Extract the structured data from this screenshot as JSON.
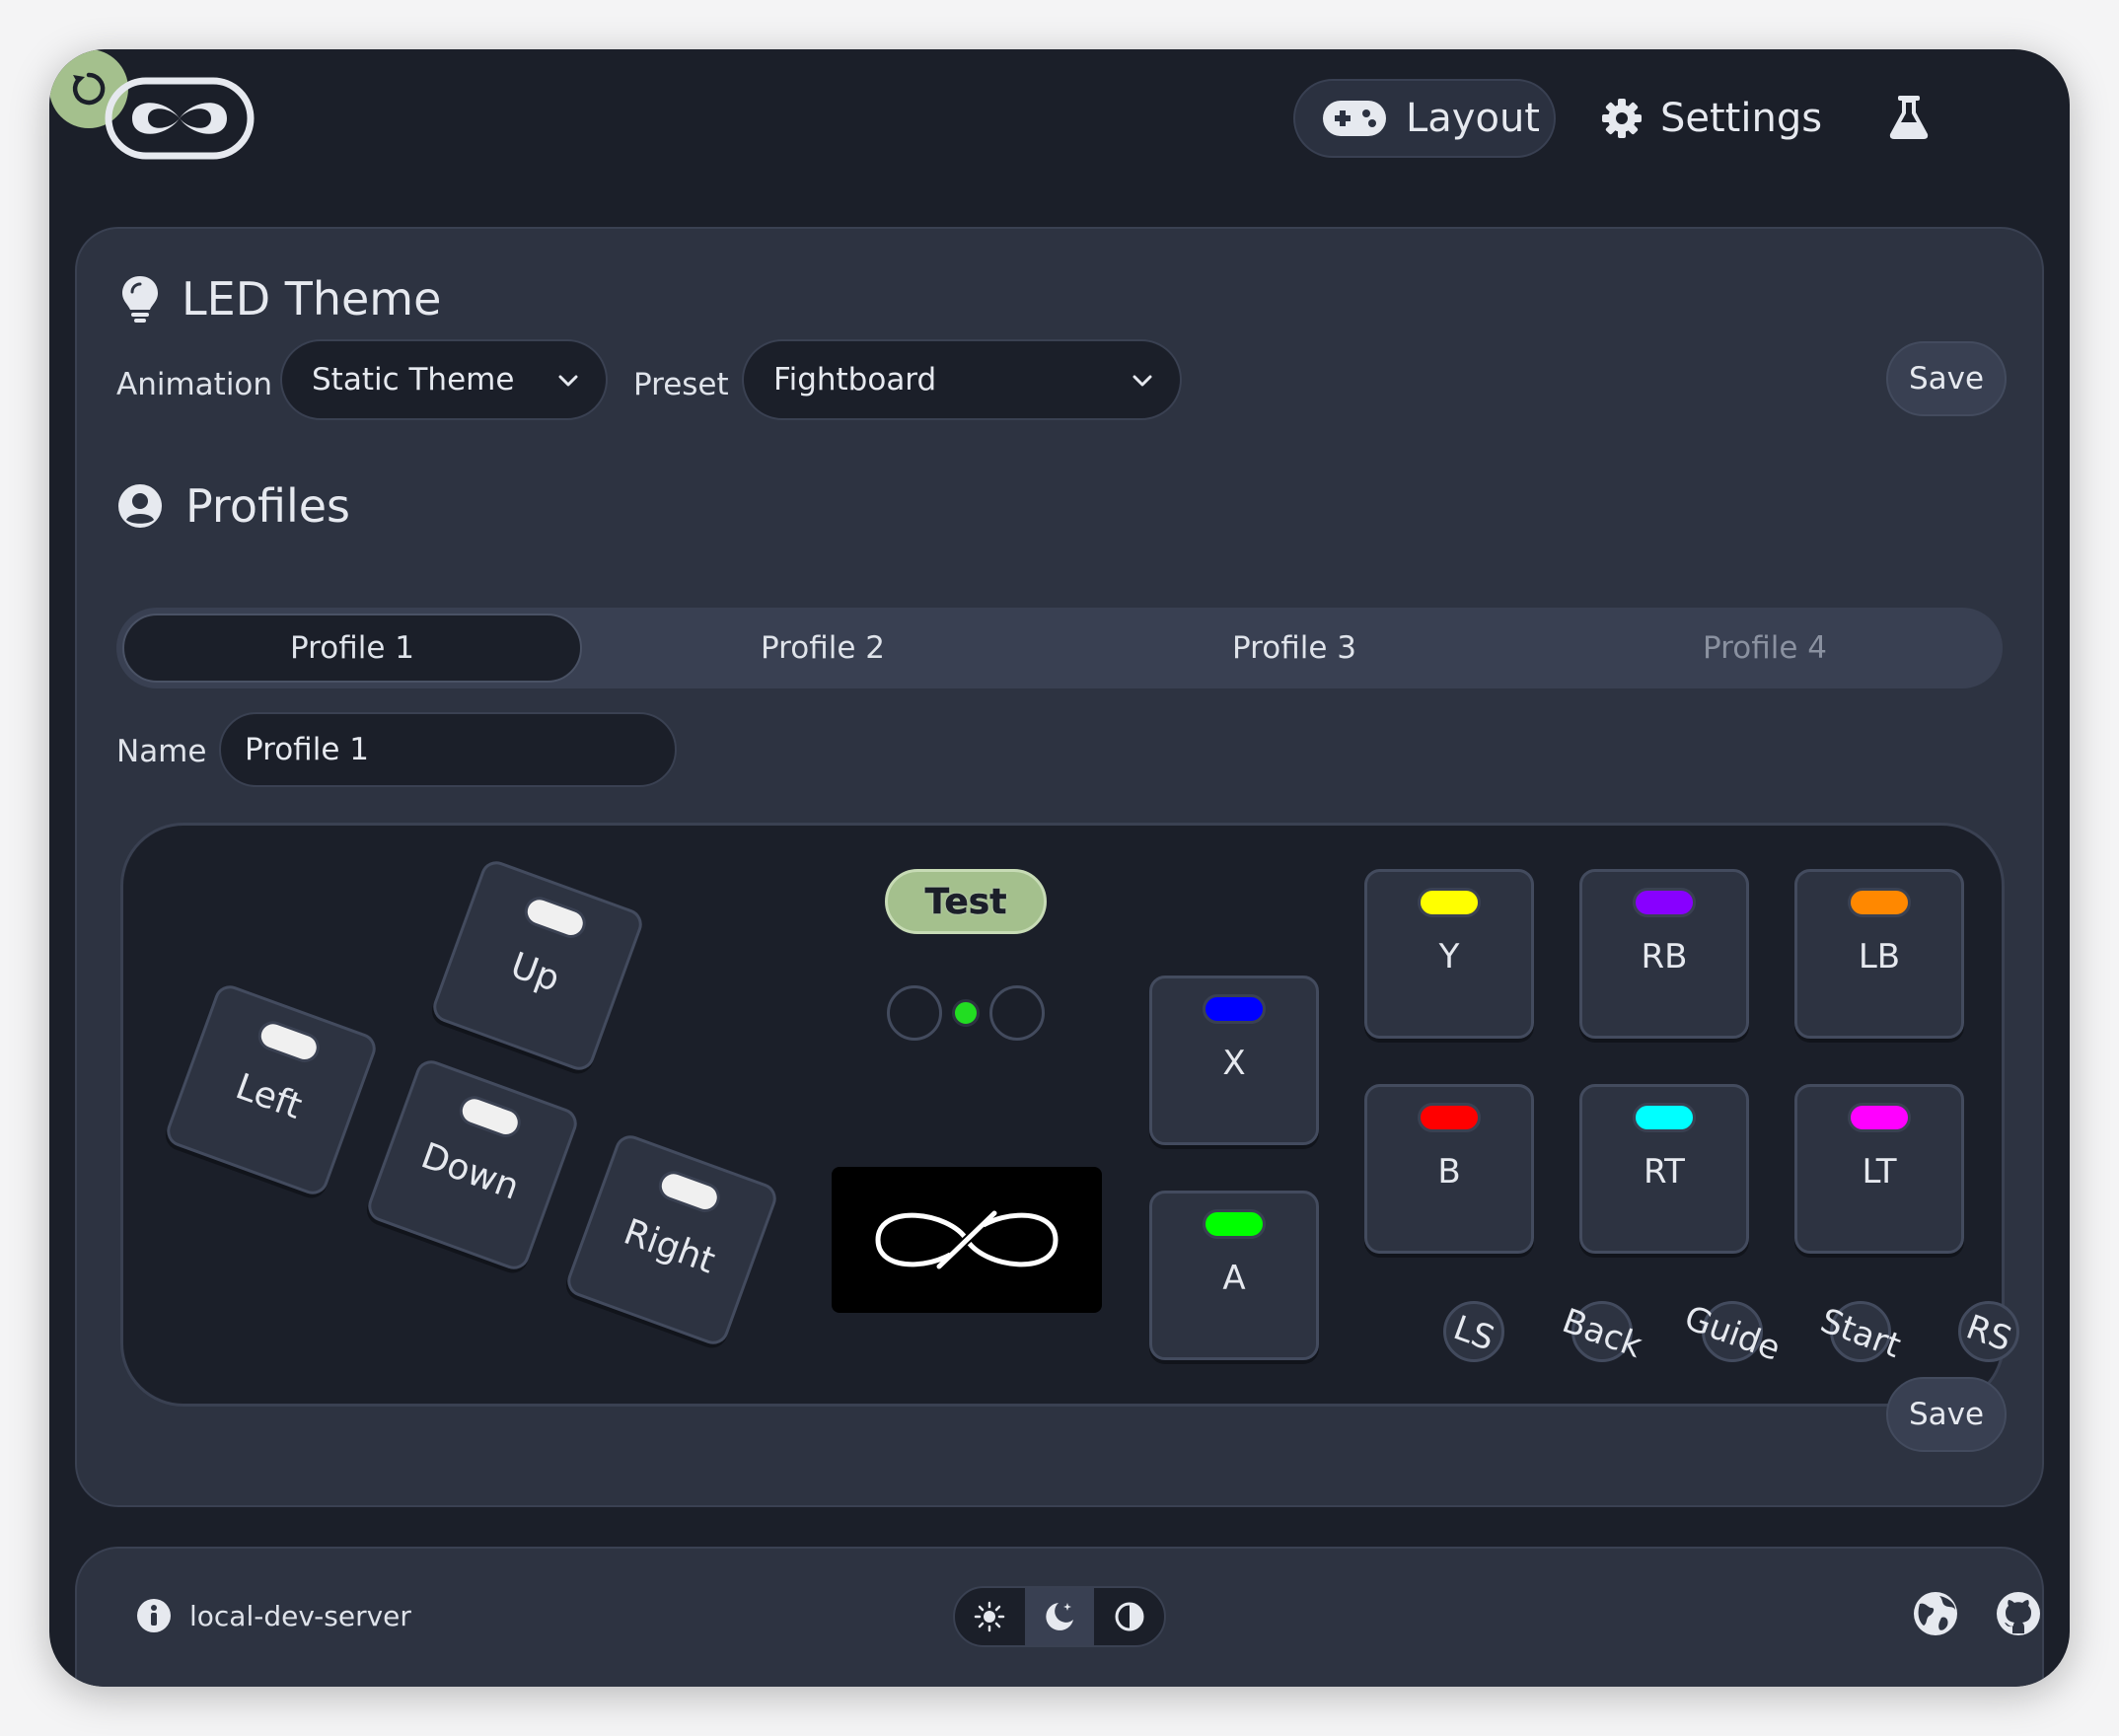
{
  "header": {
    "nav_layout": "Layout",
    "nav_settings": "Settings",
    "logo_icon": "infinity-logo-icon",
    "lab_icon": "flask-icon",
    "reboot_icon": "reboot-icon"
  },
  "led": {
    "title": "LED Theme",
    "animation_label": "Animation",
    "animation_value": "Static Theme",
    "preset_label": "Preset",
    "preset_value": "Fightboard",
    "save_label": "Save"
  },
  "profiles": {
    "title": "Profiles",
    "tabs": [
      {
        "label": "Profile 1",
        "active": true
      },
      {
        "label": "Profile 2",
        "active": false
      },
      {
        "label": "Profile 3",
        "active": false
      },
      {
        "label": "Profile 4",
        "active": false,
        "dim": true
      }
    ],
    "name_label": "Name",
    "name_value": "Profile 1",
    "save_label": "Save"
  },
  "controller": {
    "test_label": "Test",
    "directions": [
      {
        "label": "Up"
      },
      {
        "label": "Left"
      },
      {
        "label": "Down"
      },
      {
        "label": "Right"
      }
    ],
    "buttons": [
      {
        "label": "X",
        "color": "#0000ff"
      },
      {
        "label": "A",
        "color": "#00ff00"
      },
      {
        "label": "Y",
        "color": "#ffff00"
      },
      {
        "label": "RB",
        "color": "#8800ff"
      },
      {
        "label": "LB",
        "color": "#ff8800"
      },
      {
        "label": "B",
        "color": "#ff0000"
      },
      {
        "label": "RT",
        "color": "#00ffff"
      },
      {
        "label": "LT",
        "color": "#ff00ff"
      }
    ],
    "small_buttons": [
      "LS",
      "Back",
      "Guide",
      "Start",
      "RS"
    ]
  },
  "footer": {
    "server": "local-dev-server",
    "theme_options": [
      "light",
      "dark",
      "auto"
    ],
    "theme_active": "dark"
  },
  "colors": {
    "accent": "#a4c08d",
    "background": "#1b1f29",
    "card": "#2d3341"
  }
}
